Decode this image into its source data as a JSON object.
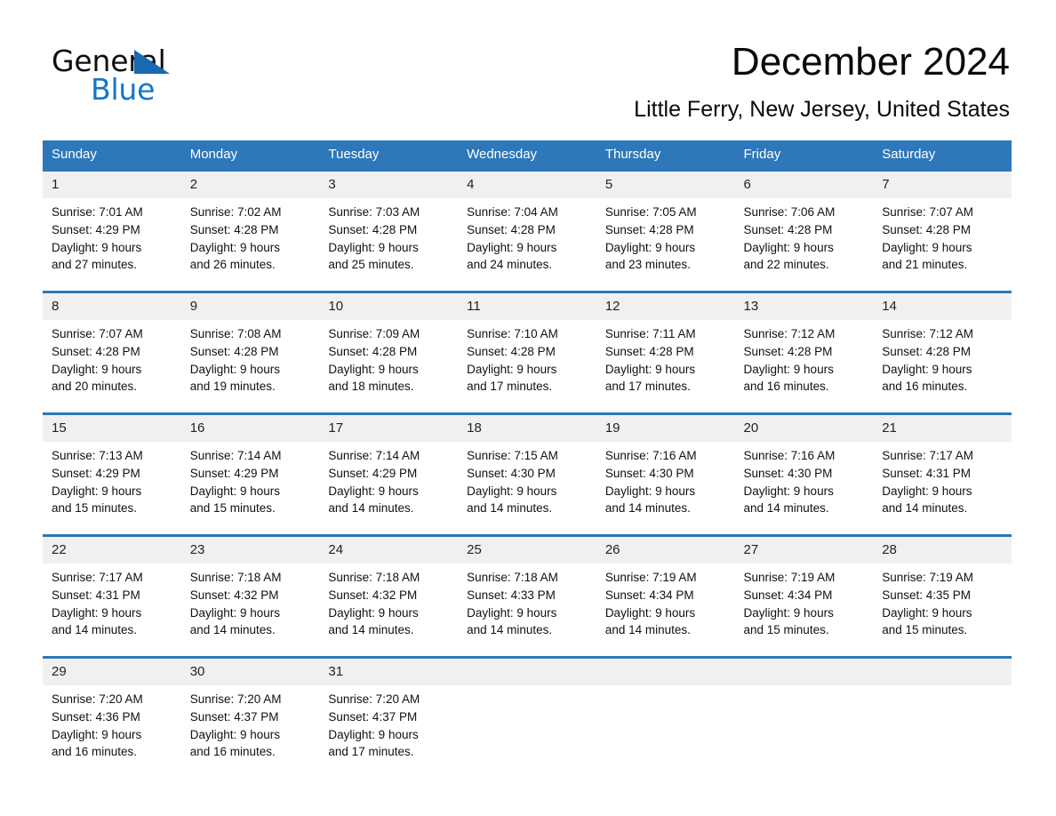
{
  "brand": {
    "logo_line1": "General",
    "logo_line2": "Blue",
    "triangle_icon": "blue-triangle-icon",
    "accent_color": "#2e77b8",
    "logo_blue": "#1476c6"
  },
  "header": {
    "month_title": "December 2024",
    "location": "Little Ferry, New Jersey, United States"
  },
  "calendar": {
    "weekday_headers": [
      "Sunday",
      "Monday",
      "Tuesday",
      "Wednesday",
      "Thursday",
      "Friday",
      "Saturday"
    ],
    "weeks": [
      [
        {
          "day": "1",
          "sunrise": "Sunrise: 7:01 AM",
          "sunset": "Sunset: 4:29 PM",
          "daylight_1": "Daylight: 9 hours",
          "daylight_2": "and 27 minutes."
        },
        {
          "day": "2",
          "sunrise": "Sunrise: 7:02 AM",
          "sunset": "Sunset: 4:28 PM",
          "daylight_1": "Daylight: 9 hours",
          "daylight_2": "and 26 minutes."
        },
        {
          "day": "3",
          "sunrise": "Sunrise: 7:03 AM",
          "sunset": "Sunset: 4:28 PM",
          "daylight_1": "Daylight: 9 hours",
          "daylight_2": "and 25 minutes."
        },
        {
          "day": "4",
          "sunrise": "Sunrise: 7:04 AM",
          "sunset": "Sunset: 4:28 PM",
          "daylight_1": "Daylight: 9 hours",
          "daylight_2": "and 24 minutes."
        },
        {
          "day": "5",
          "sunrise": "Sunrise: 7:05 AM",
          "sunset": "Sunset: 4:28 PM",
          "daylight_1": "Daylight: 9 hours",
          "daylight_2": "and 23 minutes."
        },
        {
          "day": "6",
          "sunrise": "Sunrise: 7:06 AM",
          "sunset": "Sunset: 4:28 PM",
          "daylight_1": "Daylight: 9 hours",
          "daylight_2": "and 22 minutes."
        },
        {
          "day": "7",
          "sunrise": "Sunrise: 7:07 AM",
          "sunset": "Sunset: 4:28 PM",
          "daylight_1": "Daylight: 9 hours",
          "daylight_2": "and 21 minutes."
        }
      ],
      [
        {
          "day": "8",
          "sunrise": "Sunrise: 7:07 AM",
          "sunset": "Sunset: 4:28 PM",
          "daylight_1": "Daylight: 9 hours",
          "daylight_2": "and 20 minutes."
        },
        {
          "day": "9",
          "sunrise": "Sunrise: 7:08 AM",
          "sunset": "Sunset: 4:28 PM",
          "daylight_1": "Daylight: 9 hours",
          "daylight_2": "and 19 minutes."
        },
        {
          "day": "10",
          "sunrise": "Sunrise: 7:09 AM",
          "sunset": "Sunset: 4:28 PM",
          "daylight_1": "Daylight: 9 hours",
          "daylight_2": "and 18 minutes."
        },
        {
          "day": "11",
          "sunrise": "Sunrise: 7:10 AM",
          "sunset": "Sunset: 4:28 PM",
          "daylight_1": "Daylight: 9 hours",
          "daylight_2": "and 17 minutes."
        },
        {
          "day": "12",
          "sunrise": "Sunrise: 7:11 AM",
          "sunset": "Sunset: 4:28 PM",
          "daylight_1": "Daylight: 9 hours",
          "daylight_2": "and 17 minutes."
        },
        {
          "day": "13",
          "sunrise": "Sunrise: 7:12 AM",
          "sunset": "Sunset: 4:28 PM",
          "daylight_1": "Daylight: 9 hours",
          "daylight_2": "and 16 minutes."
        },
        {
          "day": "14",
          "sunrise": "Sunrise: 7:12 AM",
          "sunset": "Sunset: 4:28 PM",
          "daylight_1": "Daylight: 9 hours",
          "daylight_2": "and 16 minutes."
        }
      ],
      [
        {
          "day": "15",
          "sunrise": "Sunrise: 7:13 AM",
          "sunset": "Sunset: 4:29 PM",
          "daylight_1": "Daylight: 9 hours",
          "daylight_2": "and 15 minutes."
        },
        {
          "day": "16",
          "sunrise": "Sunrise: 7:14 AM",
          "sunset": "Sunset: 4:29 PM",
          "daylight_1": "Daylight: 9 hours",
          "daylight_2": "and 15 minutes."
        },
        {
          "day": "17",
          "sunrise": "Sunrise: 7:14 AM",
          "sunset": "Sunset: 4:29 PM",
          "daylight_1": "Daylight: 9 hours",
          "daylight_2": "and 14 minutes."
        },
        {
          "day": "18",
          "sunrise": "Sunrise: 7:15 AM",
          "sunset": "Sunset: 4:30 PM",
          "daylight_1": "Daylight: 9 hours",
          "daylight_2": "and 14 minutes."
        },
        {
          "day": "19",
          "sunrise": "Sunrise: 7:16 AM",
          "sunset": "Sunset: 4:30 PM",
          "daylight_1": "Daylight: 9 hours",
          "daylight_2": "and 14 minutes."
        },
        {
          "day": "20",
          "sunrise": "Sunrise: 7:16 AM",
          "sunset": "Sunset: 4:30 PM",
          "daylight_1": "Daylight: 9 hours",
          "daylight_2": "and 14 minutes."
        },
        {
          "day": "21",
          "sunrise": "Sunrise: 7:17 AM",
          "sunset": "Sunset: 4:31 PM",
          "daylight_1": "Daylight: 9 hours",
          "daylight_2": "and 14 minutes."
        }
      ],
      [
        {
          "day": "22",
          "sunrise": "Sunrise: 7:17 AM",
          "sunset": "Sunset: 4:31 PM",
          "daylight_1": "Daylight: 9 hours",
          "daylight_2": "and 14 minutes."
        },
        {
          "day": "23",
          "sunrise": "Sunrise: 7:18 AM",
          "sunset": "Sunset: 4:32 PM",
          "daylight_1": "Daylight: 9 hours",
          "daylight_2": "and 14 minutes."
        },
        {
          "day": "24",
          "sunrise": "Sunrise: 7:18 AM",
          "sunset": "Sunset: 4:32 PM",
          "daylight_1": "Daylight: 9 hours",
          "daylight_2": "and 14 minutes."
        },
        {
          "day": "25",
          "sunrise": "Sunrise: 7:18 AM",
          "sunset": "Sunset: 4:33 PM",
          "daylight_1": "Daylight: 9 hours",
          "daylight_2": "and 14 minutes."
        },
        {
          "day": "26",
          "sunrise": "Sunrise: 7:19 AM",
          "sunset": "Sunset: 4:34 PM",
          "daylight_1": "Daylight: 9 hours",
          "daylight_2": "and 14 minutes."
        },
        {
          "day": "27",
          "sunrise": "Sunrise: 7:19 AM",
          "sunset": "Sunset: 4:34 PM",
          "daylight_1": "Daylight: 9 hours",
          "daylight_2": "and 15 minutes."
        },
        {
          "day": "28",
          "sunrise": "Sunrise: 7:19 AM",
          "sunset": "Sunset: 4:35 PM",
          "daylight_1": "Daylight: 9 hours",
          "daylight_2": "and 15 minutes."
        }
      ],
      [
        {
          "day": "29",
          "sunrise": "Sunrise: 7:20 AM",
          "sunset": "Sunset: 4:36 PM",
          "daylight_1": "Daylight: 9 hours",
          "daylight_2": "and 16 minutes."
        },
        {
          "day": "30",
          "sunrise": "Sunrise: 7:20 AM",
          "sunset": "Sunset: 4:37 PM",
          "daylight_1": "Daylight: 9 hours",
          "daylight_2": "and 16 minutes."
        },
        {
          "day": "31",
          "sunrise": "Sunrise: 7:20 AM",
          "sunset": "Sunset: 4:37 PM",
          "daylight_1": "Daylight: 9 hours",
          "daylight_2": "and 17 minutes."
        },
        {
          "day": "",
          "sunrise": "",
          "sunset": "",
          "daylight_1": "",
          "daylight_2": ""
        },
        {
          "day": "",
          "sunrise": "",
          "sunset": "",
          "daylight_1": "",
          "daylight_2": ""
        },
        {
          "day": "",
          "sunrise": "",
          "sunset": "",
          "daylight_1": "",
          "daylight_2": ""
        },
        {
          "day": "",
          "sunrise": "",
          "sunset": "",
          "daylight_1": "",
          "daylight_2": ""
        }
      ]
    ]
  }
}
